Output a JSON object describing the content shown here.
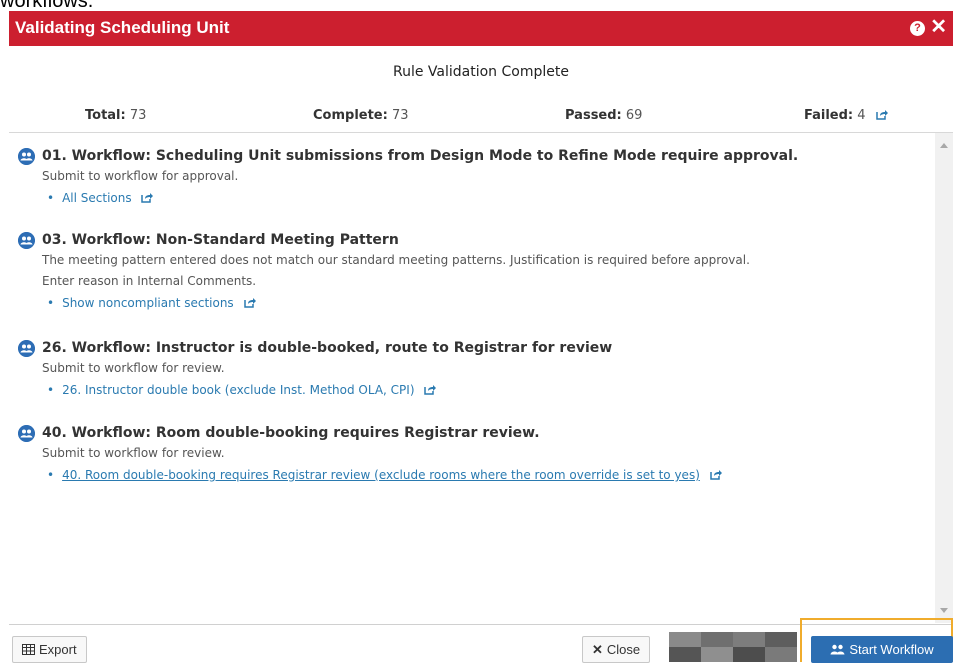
{
  "top_fragment": "workflows.",
  "dialog": {
    "title": "Validating Scheduling Unit",
    "help_icon": "question-circle-icon",
    "close_icon": "close-x-icon"
  },
  "heading": "Rule Validation Complete",
  "summary": {
    "total_label": "Total:",
    "total_value": "73",
    "complete_label": "Complete:",
    "complete_value": "73",
    "passed_label": "Passed:",
    "passed_value": "69",
    "failed_label": "Failed:",
    "failed_value": "4"
  },
  "rules": [
    {
      "title": "01. Workflow: Scheduling Unit submissions from Design Mode to Refine Mode require approval.",
      "description": [
        "Submit to workflow for approval."
      ],
      "link": "All Sections"
    },
    {
      "title": "03. Workflow: Non-Standard Meeting Pattern",
      "description": [
        "The meeting pattern entered does not match our standard meeting patterns. Justification is required before approval.",
        "Enter reason in Internal Comments."
      ],
      "link": "Show noncompliant sections"
    },
    {
      "title": "26. Workflow: Instructor is double-booked, route to Registrar for review",
      "description": [
        "Submit to workflow for review."
      ],
      "link": "26. Instructor double book (exclude Inst. Method OLA, CPI)"
    },
    {
      "title": "40. Workflow: Room double-booking requires Registrar review.",
      "description": [
        "Submit to workflow for review."
      ],
      "link": "40. Room double-booking requires Registrar review (exclude rooms where the room override is set to yes)"
    }
  ],
  "footer": {
    "export_label": "Export",
    "close_label": "Close",
    "start_workflow_label": "Start Workflow"
  },
  "colors": {
    "titlebar": "#cc1f2f",
    "link": "#2a7ab0",
    "primary_button": "#2c6eb2",
    "focus": "#f0ac2c"
  }
}
